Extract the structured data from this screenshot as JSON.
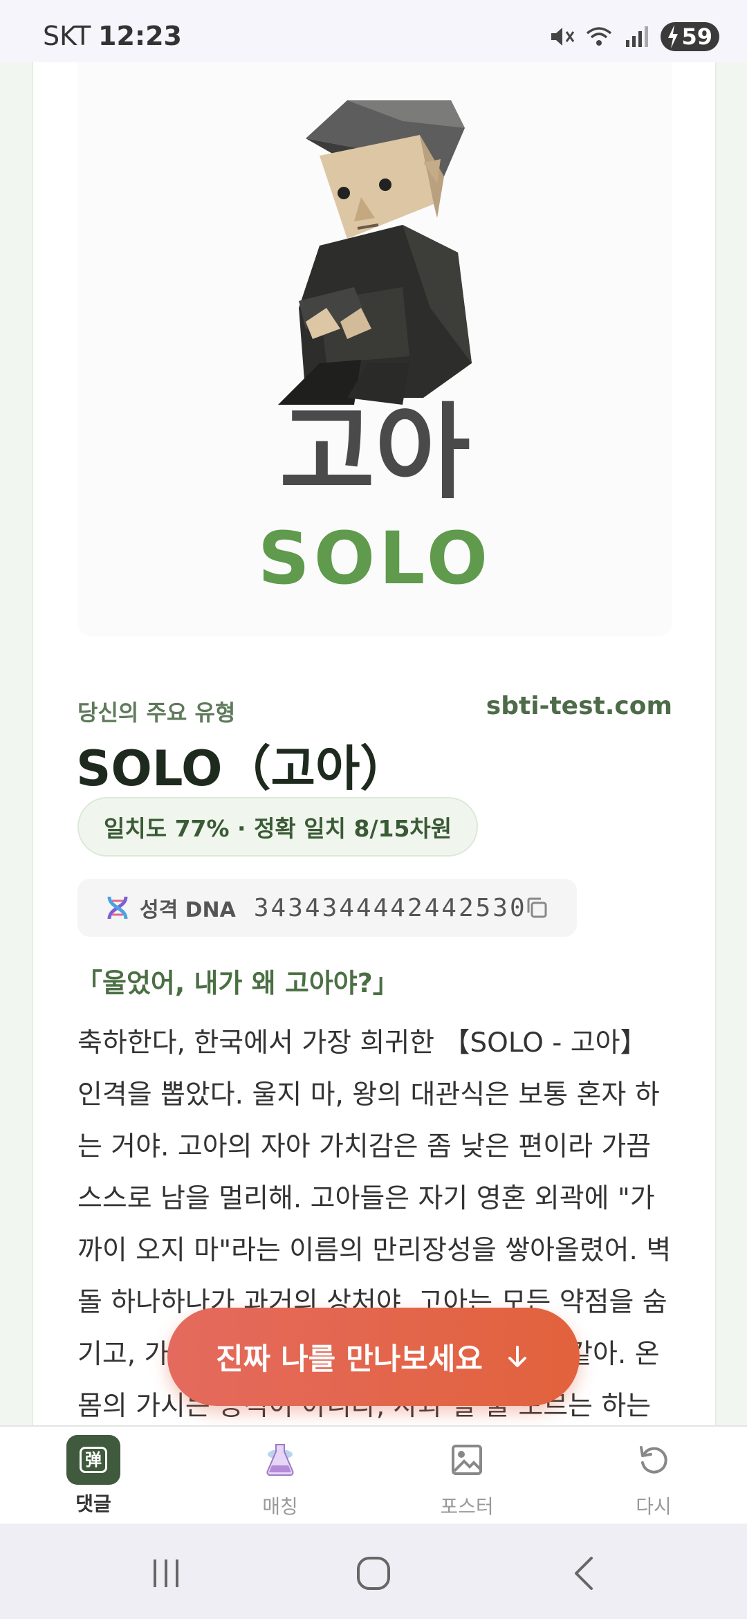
{
  "status_bar": {
    "carrier": "SKT",
    "time": "12:23",
    "battery": "59",
    "icons": [
      "mute-icon",
      "wifi-icon",
      "signal-icon",
      "charging-icon"
    ]
  },
  "hero": {
    "title_ko": "고아",
    "title_en": "SOLO",
    "image": "blocky-character-sitting-illustration"
  },
  "result": {
    "sub_label": "당신의 주요 유형",
    "site": "sbti-test.com",
    "title": "SOLO（고아）",
    "match": "일치도 77% · 정확 일치 8/15차원",
    "dna_label": "성격 DNA",
    "dna_code": "3434344442442530",
    "quote": "「울었어, 내가 왜 고아야?」",
    "description": "축하한다, 한국에서 가장 희귀한 【SOLO - 고아】 인격을 뽑았다. 울지 마, 왕의 대관식은 보통 혼자 하는 거야. 고아의 자아 가치감은 좀 낮은 편이라 가끔 스스로 남을 멀리해. 고아들은 자기 영혼 외곽에 \"가까이 오지 마\"라는 이름의 만리장성을 쌓아올렸어. 벽돌 하나하나가 과거의 상처야. 고아는 모든 약점을 숨기고, 가장 뾰족한 가시를 드러내. 고슴도치 같아. 온몸의 가시는 공격이 아니라, 사과 할 줄 모르는 하는"
  },
  "cta": {
    "label": "진짜 나를 만나보세요"
  },
  "bottom_nav": [
    {
      "label": "댓글",
      "icon_text": "弹",
      "active": true
    },
    {
      "label": "매칭",
      "active": false
    },
    {
      "label": "포스터",
      "active": false
    },
    {
      "label": "다시",
      "active": false
    }
  ],
  "colors": {
    "accent_green": "#5f9a4d",
    "dark_green": "#3f5a3c",
    "cta": "#e2623c"
  }
}
